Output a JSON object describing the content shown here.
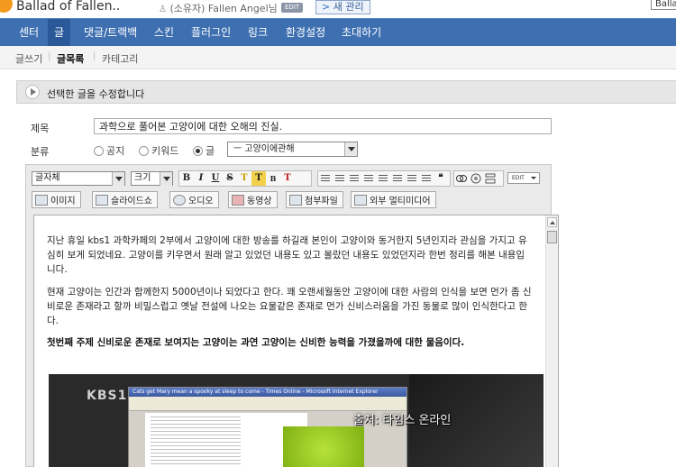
{
  "header": {
    "blog_title": "Ballad of Fallen..",
    "owner_prefix": "(소유자)",
    "owner_name": "Fallen Angel님",
    "edit_chip": "EDIT",
    "new_manage": "새 관리",
    "right_box": "Balla"
  },
  "main_nav": [
    "센터",
    "글",
    "댓글/트랙백",
    "스킨",
    "플러그인",
    "링크",
    "환경설정",
    "초대하기"
  ],
  "sub_nav": [
    "글쓰기",
    "글목록",
    "카테고리"
  ],
  "notice": "선택한 글을 수정합니다",
  "form": {
    "title_label": "제목",
    "title_value": "과학으로 풀어본 고양이에 대한 오해의 진실.",
    "category_label": "분류",
    "radio_public": "공지",
    "radio_keyword": "키워드",
    "radio_post": "글",
    "category_value": "ㅡ 고양이에관해"
  },
  "toolbar": {
    "font_select": "글자체",
    "size_select": "크기",
    "btn_bold": "B",
    "btn_italic": "I",
    "btn_underline": "U",
    "btn_strike": "S",
    "btn_color": "T",
    "btn_bg": "T",
    "btn_box": "B",
    "btn_clear": "T",
    "btn_quote": "❝",
    "edit_mode": "EDIT",
    "media": [
      "이미지",
      "슬라이드쇼",
      "오디오",
      "동영상",
      "첨부파일",
      "외부 멀티미디어"
    ]
  },
  "article": {
    "p1": "지난 휴일 kbs1 과학카페의 2부에서 고양이에 대한 방송를 하길래 본인이 고양이와 동거한지 5년인지라 관심을 가지고 유심히 보게 되었네요. 고양이를 키우면서 원래 알고 있었던 내용도 있고 몰랐던 내용도 있었던지라 한번 정리를 해본 내용입니다.",
    "p2": "현재 고양이는 인간과 함께한지 5000년이나 되었다고 한다. 꽤 오랜세월동안 고양이에 대한 사람의 인식을 보면 먼가 좀 신비로운 존재라고 할까 비밀스럽고 옛날 전설에 나오는 요물같은 존재로 먼가 신비스러움을 가진 동물로 많이 인식한다고 한다.",
    "p3": "첫번째 주제 신비로운 존재로 보여지는 고양이는 과연 고양이는 신비한 능력을 가졌을까에 대한 물음이다.",
    "image_channel": "KBS1HD",
    "image_window_title": "Cats get Mary mean a spooky at sleep to come - Times Online - Microsoft Internet Explorer",
    "image_caption": "출처: 타임스 온라인"
  }
}
